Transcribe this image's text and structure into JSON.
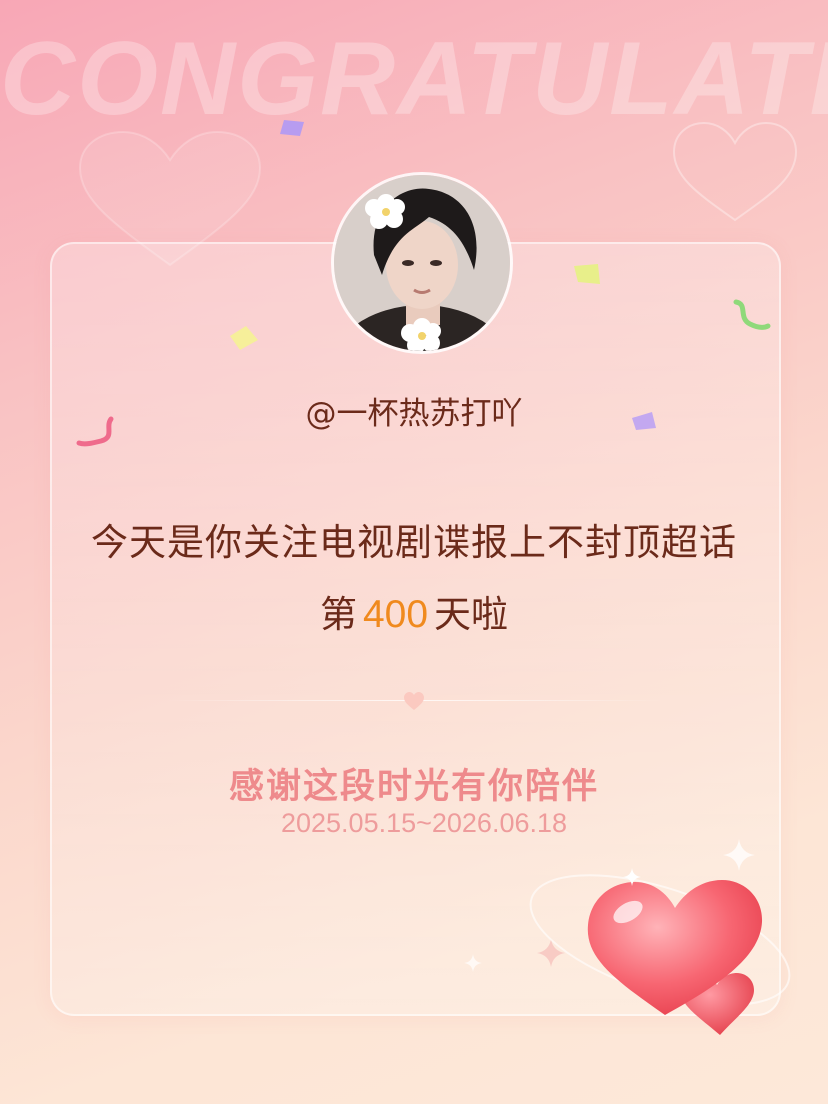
{
  "background": {
    "watermark": "CONGRATULATE"
  },
  "profile": {
    "handle": "@一杯热苏打吖",
    "avatar_icon": "avatar"
  },
  "message": {
    "line1": "今天是你关注电视剧谍报上不封顶超话",
    "line2_prefix": "第",
    "day_count": "400",
    "line2_suffix": "天啦"
  },
  "footer": {
    "thanks": "感谢这段时光有你陪伴",
    "date_range": "2025.05.15~2026.06.18"
  },
  "colors": {
    "text_dark": "#6b2a1a",
    "accent_number": "#f08a1e",
    "thanks_pink": "#ee8a8c",
    "heart_red": "#f45b67"
  }
}
